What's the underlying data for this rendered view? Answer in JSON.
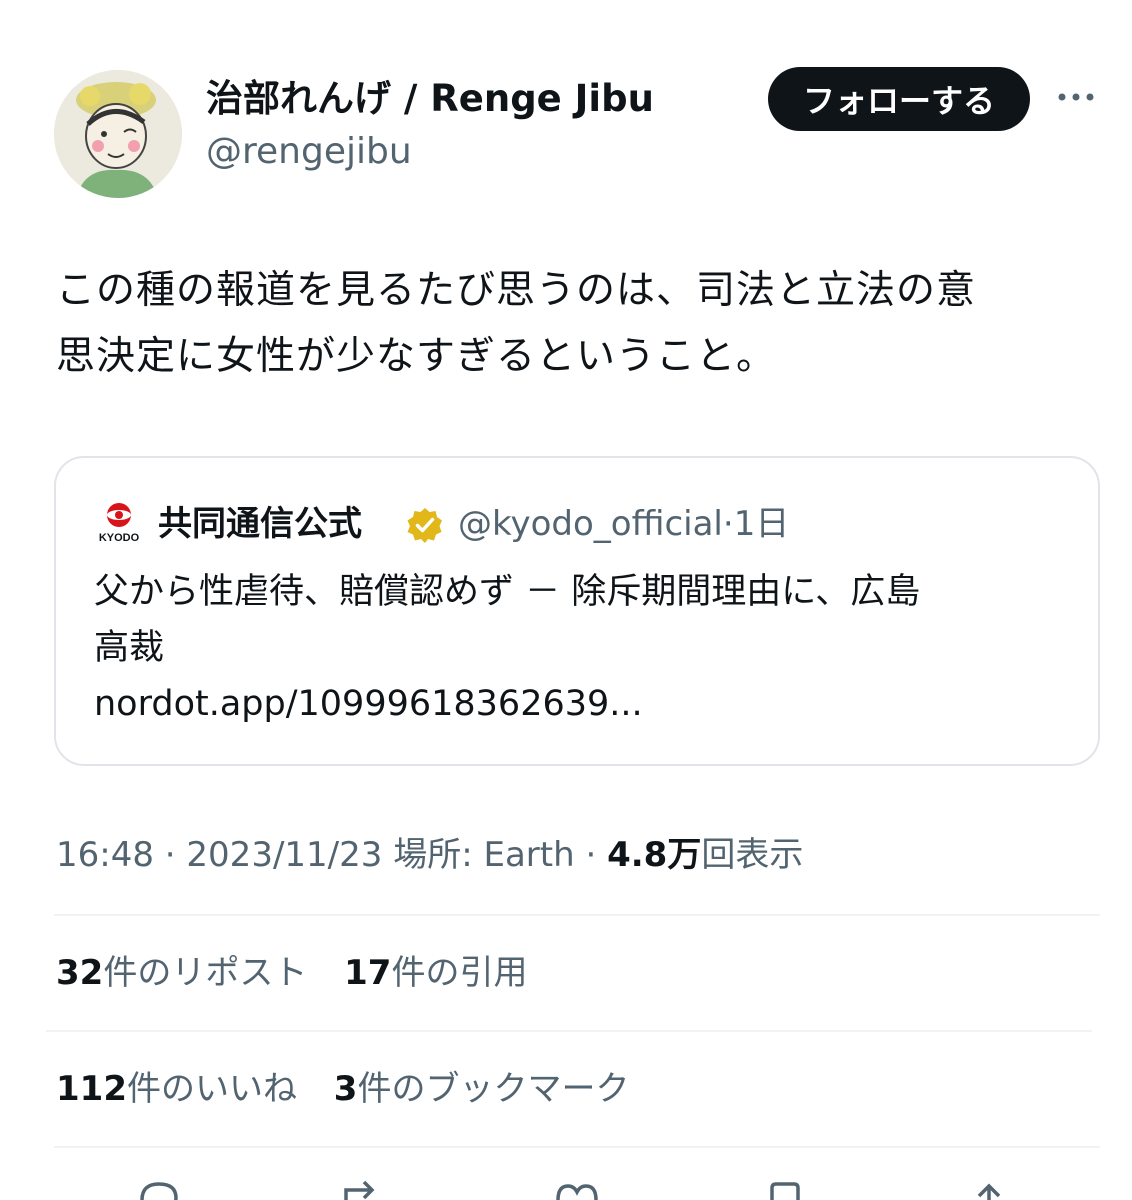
{
  "author": {
    "display_name": "治部れんげ / Renge Jibu",
    "handle": "@rengejibu"
  },
  "follow_label": "フォローする",
  "tweet_text_line1": "この種の報道を見るたび思うのは、司法と立法の意",
  "tweet_text_line2": "思決定に女性が少なすぎるということ。",
  "quote": {
    "name": "共同通信公式",
    "handle": "@kyodo_official",
    "separator": "·",
    "age": "1日",
    "logo_text": "KYODO",
    "text_line1": "父から性虐待、賠償認めず － 除斥期間理由に、広島",
    "text_line2": "高裁",
    "link": "nordot.app/10999618362639..."
  },
  "meta": {
    "time": "16:48",
    "sep1": "·",
    "date": "2023/11/23",
    "location": "場所: Earth",
    "sep2": "·",
    "views_count": "4.8万",
    "views_label": "回表示"
  },
  "stats": {
    "reposts_count": "32",
    "reposts_label": "件のリポスト",
    "quotes_count": "17",
    "quotes_label": "件の引用",
    "likes_count": "112",
    "likes_label": "件のいいね",
    "bookmarks_count": "3",
    "bookmarks_label": "件のブックマーク"
  },
  "colors": {
    "text_primary": "#0f1419",
    "text_secondary": "#536471",
    "border": "#e1e5e9",
    "verified_gold": "#e2b719",
    "kyodo_red": "#d7141a"
  }
}
